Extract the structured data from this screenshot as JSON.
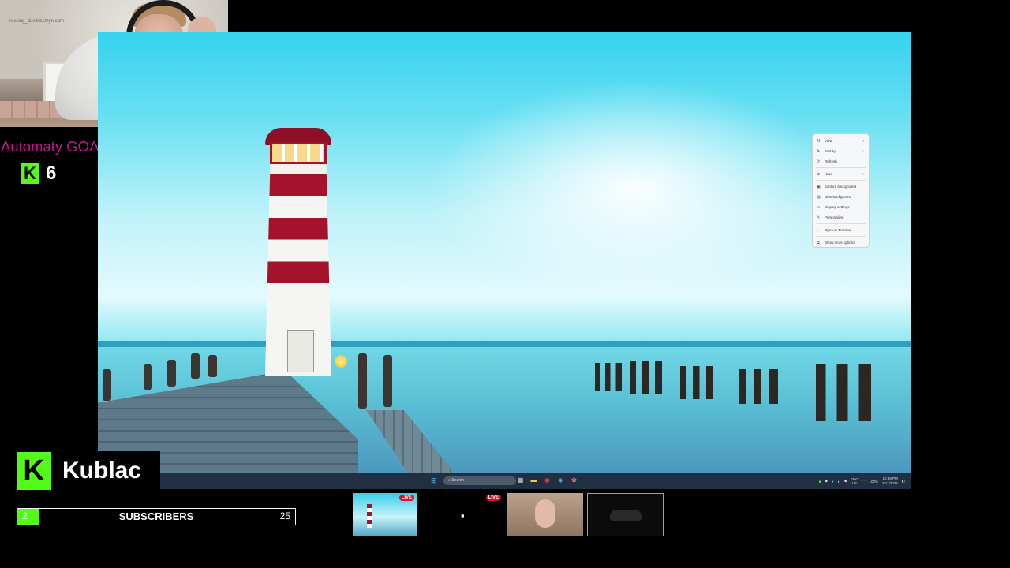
{
  "webcam": {
    "watermark": "rossing_danilrissmyn.com"
  },
  "overlay": {
    "top_donator": "Automaty GOAT top donator",
    "kick_logo": "K",
    "top_donation_amount": "6",
    "channel_name": "Kublac",
    "sub_goal": {
      "current": "2",
      "label": "SUBSCRIBERS",
      "goal": "25",
      "progress": 0.08
    }
  },
  "context_menu": {
    "items": [
      {
        "icon": "view-icon",
        "glyph": "☷",
        "label": "View",
        "submenu": true
      },
      {
        "icon": "sort-icon",
        "glyph": "⇅",
        "label": "Sort by",
        "submenu": true
      },
      {
        "icon": "refresh-icon",
        "glyph": "⟳",
        "label": "Refresh",
        "submenu": false
      },
      {
        "sep": true
      },
      {
        "icon": "new-icon",
        "glyph": "⊕",
        "label": "New",
        "submenu": true
      },
      {
        "sep": true
      },
      {
        "icon": "explore-background-icon",
        "glyph": "▣",
        "label": "Explore background",
        "submenu": false
      },
      {
        "icon": "next-background-icon",
        "glyph": "▤",
        "label": "Next background",
        "submenu": false
      },
      {
        "icon": "display-settings-icon",
        "glyph": "▭",
        "label": "Display settings",
        "submenu": false
      },
      {
        "icon": "personalize-icon",
        "glyph": "✎",
        "label": "Personalize",
        "submenu": false
      },
      {
        "sep": true
      },
      {
        "icon": "terminal-icon",
        "glyph": "▸",
        "label": "Open in Terminal",
        "submenu": false
      },
      {
        "sep": true
      },
      {
        "icon": "more-options-icon",
        "glyph": "⧉",
        "label": "Show more options",
        "submenu": false
      }
    ]
  },
  "taskbar": {
    "search_placeholder": "Search",
    "lang_top": "ENG",
    "lang_bottom": "US",
    "battery": "100%",
    "time": "12:38 PM",
    "date": "2/11/2026"
  },
  "sources": {
    "live_label": "LIVE"
  },
  "colors": {
    "kick_green": "#53fc18",
    "donator_magenta": "#c0188d",
    "taskbar": "#203042",
    "live_red": "#e10d2a"
  }
}
